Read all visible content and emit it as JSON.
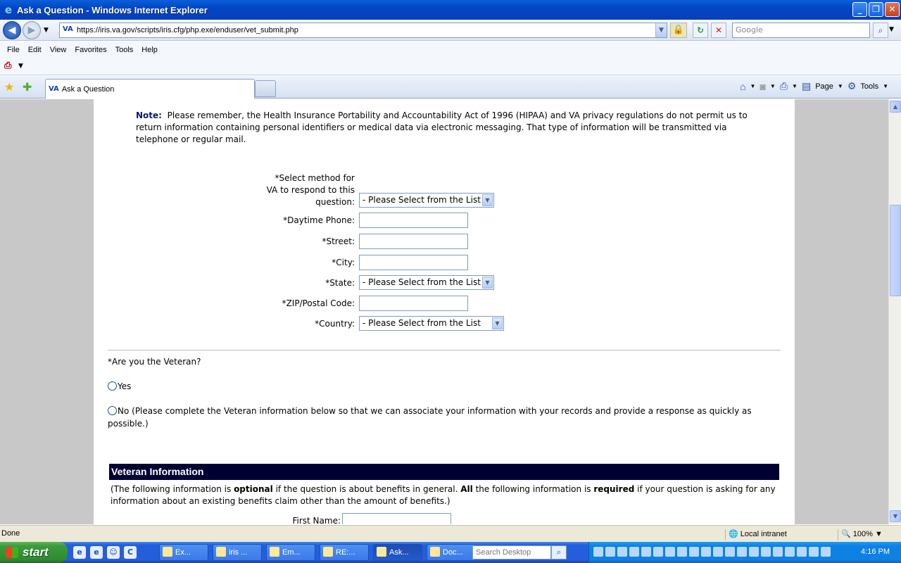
{
  "window": {
    "title": "Ask a Question - Windows Internet Explorer"
  },
  "nav": {
    "url": "https://iris.va.gov/scripts/iris.cfg/php.exe/enduser/vet_submit.php",
    "search_placeholder": "Google"
  },
  "menu": [
    "File",
    "Edit",
    "View",
    "Favorites",
    "Tools",
    "Help"
  ],
  "tab": {
    "label": "Ask a Question"
  },
  "commandbar": {
    "page_label": "Page",
    "tools_label": "Tools"
  },
  "content": {
    "note_label": "Note:",
    "note_text": "Please remember, the Health Insurance Portability and Accountability Act of 1996 (HIPAA) and VA privacy regulations do not permit us to return information containing personal identifiers or medical data via electronic messaging.  That type of information will be transmitted via telephone or regular mail.",
    "fields": {
      "method_label": "*Select method for VA to respond to this question:",
      "method_value": "- Please Select from the List",
      "phone_label": "*Daytime Phone:",
      "street_label": "*Street:",
      "city_label": "*City:",
      "state_label": "*State:",
      "state_value": "- Please Select from the List",
      "zip_label": "*ZIP/Postal Code:",
      "country_label": "*Country:",
      "country_value": "- Please Select from the List"
    },
    "veteran_question": "*Are you the Veteran?",
    "yes_label": "Yes",
    "no_label": "No (Please complete the Veteran information below so that we can associate your information with your records and provide a response as quickly as possible.)",
    "section_title": "Veteran Information",
    "section_desc_1": "(The following information is ",
    "section_desc_optional": "optional",
    "section_desc_2": " if the question is about benefits in general.   ",
    "section_desc_all": "All",
    "section_desc_3": " the following information is ",
    "section_desc_required": "required",
    "section_desc_4": " if your question is asking for any information about an existing benefits claim other than the amount of benefits.)",
    "first_name_label": "First Name:"
  },
  "status": {
    "text": "Done",
    "zone": "Local intranet",
    "zoom": "100%"
  },
  "taskbar": {
    "start_label": "start",
    "tasks": [
      "Ex...",
      "iris ...",
      "Em...",
      "RE:...",
      "Ask...",
      "Doc..."
    ],
    "desktop_search_placeholder": "Search Desktop",
    "clock": "4:16 PM"
  }
}
